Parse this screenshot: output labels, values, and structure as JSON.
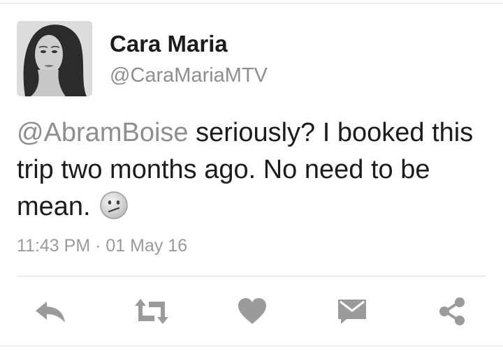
{
  "tweet": {
    "display_name": "Cara Maria",
    "handle": "@CaraMariaMTV",
    "mention": "@AbramBoise",
    "text_after_mention": " seriously? I booked this trip two months ago. No need to be mean.",
    "emoji": "confused-face",
    "timestamp": "11:43 PM · 01 May 16"
  },
  "actions": [
    {
      "name": "reply",
      "icon": "reply-icon"
    },
    {
      "name": "retweet",
      "icon": "retweet-icon"
    },
    {
      "name": "like",
      "icon": "heart-icon"
    },
    {
      "name": "direct-message",
      "icon": "envelope-icon"
    },
    {
      "name": "share",
      "icon": "share-icon"
    }
  ],
  "colors": {
    "text": "#1c1c1c",
    "muted": "#8e8e8e",
    "icon": "#9b9b9b",
    "divider": "#e0e0e0"
  }
}
